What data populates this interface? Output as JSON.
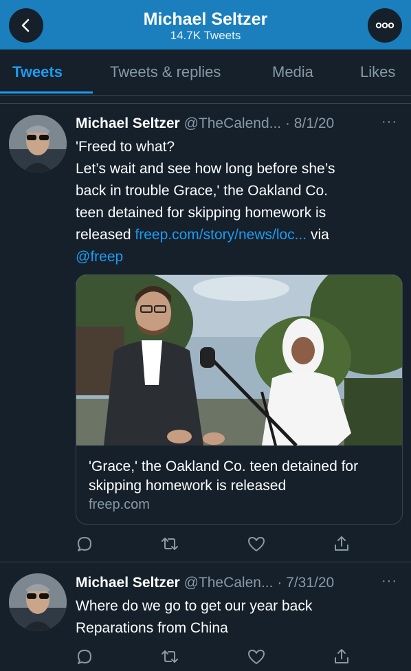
{
  "header": {
    "title": "Michael Seltzer",
    "subtitle": "14.7K Tweets",
    "back_icon": "chevron-left-icon",
    "more_icon": "more-dots-icon"
  },
  "tabs": [
    {
      "label": "Tweets",
      "active": true
    },
    {
      "label": "Tweets & replies",
      "active": false
    },
    {
      "label": "Media",
      "active": false
    },
    {
      "label": "Likes",
      "active": false
    }
  ],
  "tweets": [
    {
      "name": "Michael Seltzer",
      "handle": "@TheCalend...",
      "date": "· 8/1/20",
      "more": "···",
      "text_lines": [
        "'Freed to what?",
        "Let’s wait and see how long before she’s",
        "back in trouble Grace,' the Oakland Co.",
        "teen detained for skipping homework is"
      ],
      "text_pre_link": "released",
      "link": "freep.com/story/news/loc...",
      "text_post_link": "via",
      "mention": "@freep",
      "card": {
        "title": "'Grace,' the Oakland Co. teen detained for skipping homework is released",
        "domain": "freep.com"
      }
    },
    {
      "name": "Michael Seltzer",
      "handle": "@TheCalen...",
      "date": "· 7/31/20",
      "more": "···",
      "text_lines": [
        "Where do we go to get our year back",
        "Reparations from China"
      ]
    }
  ],
  "actions": [
    "reply-icon",
    "retweet-icon",
    "like-icon",
    "share-icon"
  ],
  "colors": {
    "background": "#15202b",
    "header": "#1b7fbe",
    "accent": "#1d9bf0",
    "muted": "#8899a6",
    "border": "#38444d"
  }
}
